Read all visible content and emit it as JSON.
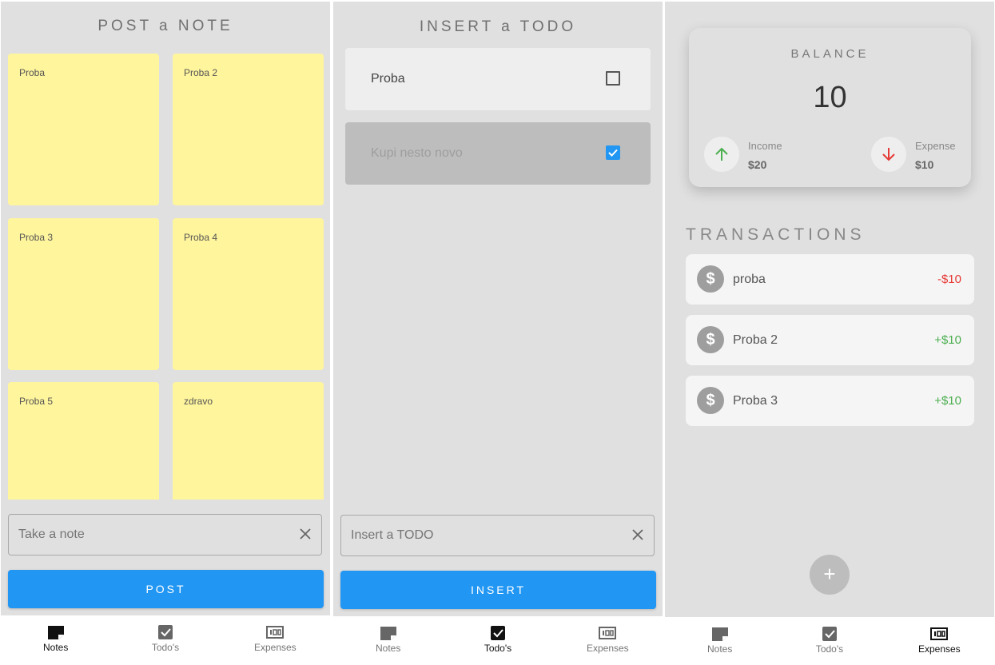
{
  "notes_screen": {
    "title": "POST a NOTE",
    "notes": [
      "Proba",
      "Proba 2",
      "Proba 3",
      "Proba 4",
      "Proba 5",
      "zdravo"
    ],
    "input_placeholder": "Take a note",
    "post_label": "POST"
  },
  "todo_screen": {
    "title": "INSERT a TODO",
    "todos": [
      {
        "label": "Proba",
        "done": false
      },
      {
        "label": "Kupi nesto novo",
        "done": true
      }
    ],
    "input_placeholder": "Insert a TODO",
    "insert_label": "INSERT"
  },
  "expenses_screen": {
    "balance_label": "BALANCE",
    "balance_value": "10",
    "income_label": "Income",
    "income_amount": "$20",
    "expense_label": "Expense",
    "expense_amount": "$10",
    "transactions_title": "TRANSACTIONS",
    "transactions": [
      {
        "name": "proba",
        "amount": "-$10"
      },
      {
        "name": "Proba 2",
        "amount": "+$10"
      },
      {
        "name": "Proba 3",
        "amount": "+$10"
      }
    ],
    "fab_label": "+"
  },
  "nav": {
    "notes": "Notes",
    "todos": "Todo's",
    "expenses": "Expenses"
  },
  "colors": {
    "accent": "#2196f3",
    "note_yellow": "#fff59d",
    "income_green": "#4caf50",
    "expense_red": "#e53935"
  }
}
